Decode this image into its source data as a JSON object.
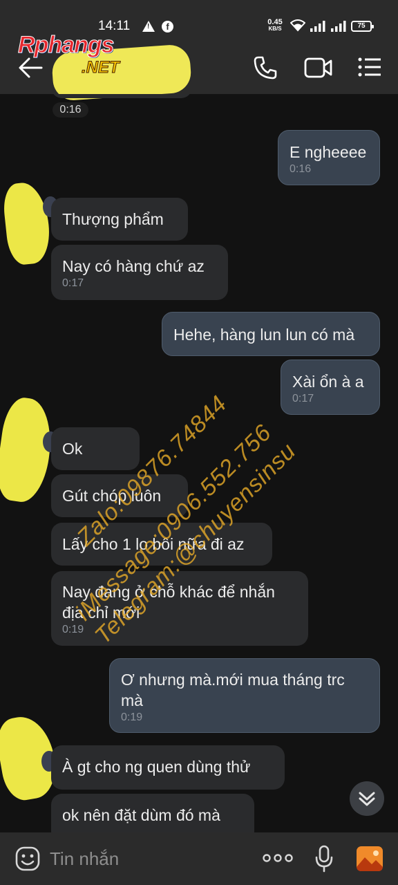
{
  "status_bar": {
    "time": "14:11",
    "net_speed_value": "0.45",
    "net_speed_unit": "KB/S",
    "battery": "75"
  },
  "watermark": {
    "logo_main": "Rphangs",
    "logo_sub": ".NET",
    "lines": [
      "Zalo:09876.74844",
      "iMessage:0906.552.756",
      "Telegram:@chuyensinsu"
    ]
  },
  "messages": [
    {
      "text": "E ngheeee",
      "time": "0:16"
    },
    {
      "text": "Thượng phẩm"
    },
    {
      "text": "Nay có hàng chứ az",
      "time": "0:17"
    },
    {
      "text": "Hehe, hàng lun lun có mà"
    },
    {
      "text": "Xài ổn à a",
      "time": "0:17"
    },
    {
      "text": "Ok"
    },
    {
      "text": "Gút chóp luôn"
    },
    {
      "text": "Lấy cho 1 lo bôi nữa đi az"
    },
    {
      "text": "Nay đang ở chỗ khác để nhắn địa chỉ mới",
      "time": "0:19"
    },
    {
      "text": "Ơ nhưng mà.mới mua tháng trc mà",
      "time": "0:19"
    },
    {
      "text": "À gt cho ng quen dùng thử"
    },
    {
      "text": "ok nên đặt dùm đó mà"
    }
  ],
  "time_pill": "0:16",
  "composer": {
    "placeholder": "Tin nhắn"
  },
  "colors": {
    "incoming_bubble": "#2a2b2d",
    "outgoing_bubble": "#394350",
    "background": "#121212",
    "bar": "#2b2b2b"
  },
  "icons": [
    "back-arrow",
    "phone",
    "video-camera",
    "menu-lines",
    "emoji-smile",
    "more-dots",
    "microphone",
    "image-gallery",
    "chevron-double-down"
  ]
}
